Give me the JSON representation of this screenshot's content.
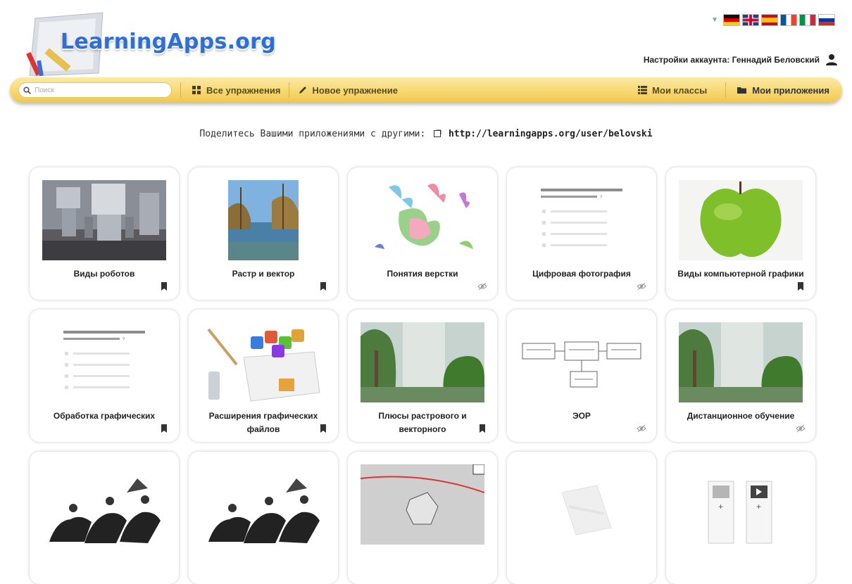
{
  "header": {
    "logo_text": "LearningApps.org",
    "account_label": "Настройки аккаунта: Геннадий Беловский",
    "languages": [
      "de",
      "gb",
      "es",
      "fr",
      "it",
      "ru"
    ]
  },
  "nav": {
    "search_placeholder": "Поиск",
    "items": [
      {
        "label": "Все упражнения",
        "icon": "grid-icon"
      },
      {
        "label": "Новое упражнение",
        "icon": "pencil-icon"
      },
      {
        "label": "Мои классы",
        "icon": "list-icon"
      },
      {
        "label": "Мои приложения",
        "icon": "folder-icon",
        "active": true
      }
    ]
  },
  "share": {
    "text": "Поделитесь Вашими приложениями с другими:",
    "url": "http://learningapps.org/user/belovski"
  },
  "apps": [
    {
      "title": "Виды роботов",
      "thumb": "robots",
      "badge": "bookmark-icon"
    },
    {
      "title": "Растр и вектор",
      "thumb": "lake",
      "badge": "bookmark-icon"
    },
    {
      "title": "Понятия верстки",
      "thumb": "butterflies",
      "badge": "eye-slash-icon"
    },
    {
      "title": "Цифровая фотография",
      "thumb": "quiz",
      "badge": "eye-slash-icon"
    },
    {
      "title": "Виды компьютерной графики",
      "thumb": "apple",
      "badge": "bookmark-icon"
    },
    {
      "title": "Обработка графических",
      "thumb": "quiz",
      "badge": "bookmark-icon"
    },
    {
      "title": "Расширения графических файлов",
      "thumb": "filebox",
      "badge": "bookmark-icon"
    },
    {
      "title": "Плюсы растрового и векторного",
      "thumb": "forest",
      "badge": "bookmark-icon"
    },
    {
      "title": "ЭОР",
      "thumb": "diagram",
      "badge": "eye-slash-icon"
    },
    {
      "title": "Дистанционное обучение",
      "thumb": "forest",
      "badge": "eye-slash-icon"
    },
    {
      "title": "",
      "thumb": "horses",
      "badge": ""
    },
    {
      "title": "",
      "thumb": "horses",
      "badge": ""
    },
    {
      "title": "",
      "thumb": "drawing",
      "badge": ""
    },
    {
      "title": "",
      "thumb": "faded",
      "badge": ""
    },
    {
      "title": "",
      "thumb": "cards",
      "badge": ""
    }
  ],
  "colors": {
    "logo_blue": "#2d6fd6",
    "nav_yellow": "#f7d870",
    "nav_text": "#5b4a20"
  }
}
